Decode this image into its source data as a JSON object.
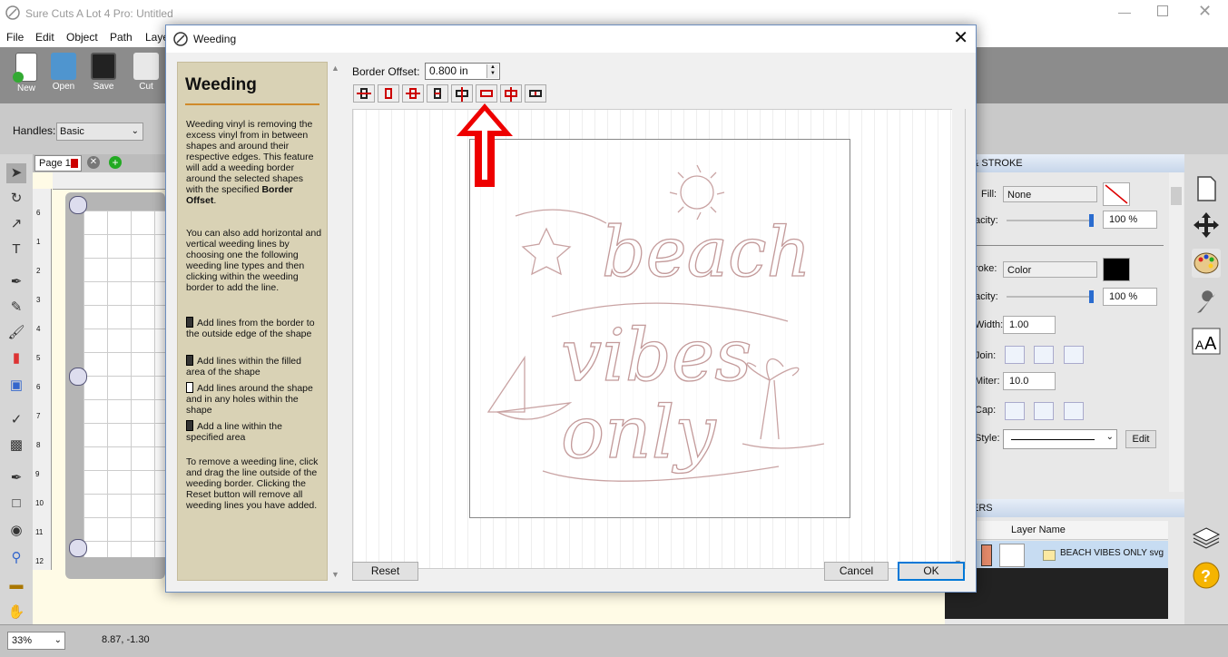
{
  "app": {
    "title": "Sure Cuts A Lot 4 Pro: Untitled"
  },
  "menu": [
    "File",
    "Edit",
    "Object",
    "Path",
    "Laye"
  ],
  "toolbar": {
    "buttons": [
      "New",
      "Open",
      "Save",
      "Cut"
    ]
  },
  "options": {
    "handles_label": "Handles:",
    "handles_value": "Basic"
  },
  "document": {
    "page_tab": "Page 1",
    "ruler_numbers": [
      "6",
      "1",
      "2",
      "3",
      "4",
      "5",
      "6",
      "7",
      "8",
      "9",
      "10",
      "11",
      "12"
    ]
  },
  "status": {
    "zoom": "33%",
    "coords": "8.87, -1.30"
  },
  "fill_stroke": {
    "header": "& STROKE",
    "fill_label": "Fill:",
    "fill_value": "None",
    "fill_opacity_label": "acity:",
    "fill_opacity": "100 %",
    "stroke_label": "roke:",
    "stroke_value": "Color",
    "stroke_opacity_label": "acity:",
    "stroke_opacity": "100 %",
    "width_label": "Width:",
    "width_value": "1.00",
    "join_label": "Join:",
    "miter_label": "Miter:",
    "miter_value": "10.0",
    "cap_label": "Cap:",
    "style_label": "Style:",
    "edit_label": "Edit"
  },
  "layers": {
    "header": "ERS",
    "col_name": "Layer Name",
    "layer_name": "BEACH VIBES ONLY svg"
  },
  "dialog": {
    "title": "Weeding",
    "help_title": "Weeding",
    "help_p1_pre": "Weeding vinyl is removing the excess vinyl from in between shapes and around their respective edges. This feature will add a weeding border around the selected shapes with the specified ",
    "help_p1_bold": "Border Offset",
    "help_p1_post": ".",
    "help_p2": "You can also add horizontal and vertical weeding lines by choosing one the following weeding line types and then clicking within the weeding border to add the line.",
    "line_types": [
      "Add lines from the border to the outside edge of the shape",
      "Add lines within the filled area of the shape",
      "Add lines around the shape and in any holes within the shape",
      "Add a line within the specified area"
    ],
    "help_p3": "To remove a weeding line, click and drag the line outside of the weeding border. Clicking the Reset button will remove all weeding lines you have added.",
    "offset_label": "Border Offset:",
    "offset_value": "0.800 in",
    "artwork_words": [
      "beach",
      "vibes",
      "only"
    ],
    "reset_label": "Reset",
    "cancel_label": "Cancel",
    "ok_label": "OK"
  },
  "colors": {
    "accent": "#0078d7",
    "arrow": "#ee0000",
    "help_bg": "#d9d2b5",
    "rule": "#d08a2a"
  }
}
